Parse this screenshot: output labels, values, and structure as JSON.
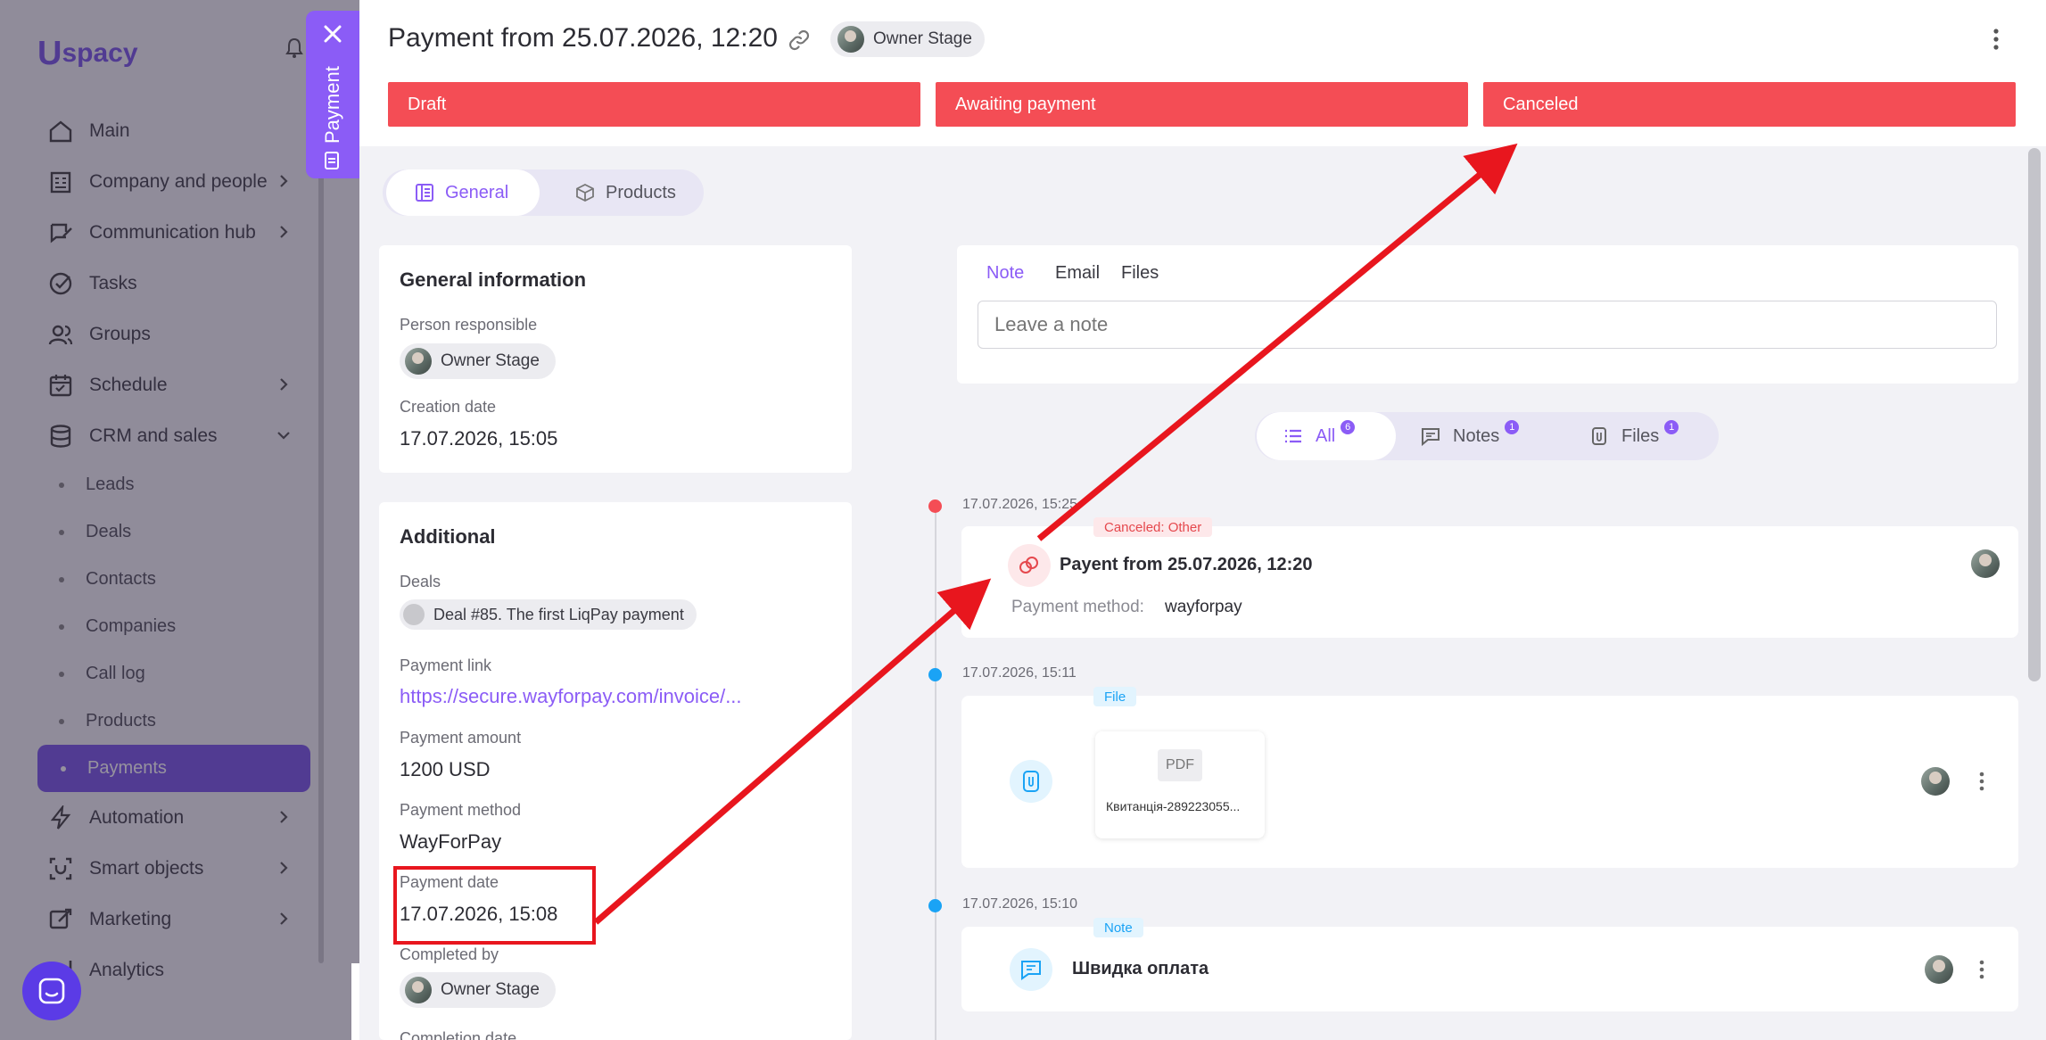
{
  "sidebar": {
    "logo_u": "U",
    "logo_text": "spacy",
    "items": [
      {
        "label": "Main",
        "icon": "home-icon",
        "has_chevron": false
      },
      {
        "label": "Company and people",
        "icon": "company-icon",
        "has_chevron": true
      },
      {
        "label": "Communication hub",
        "icon": "communication-icon",
        "has_chevron": true
      },
      {
        "label": "Tasks",
        "icon": "tasks-icon",
        "has_chevron": false
      },
      {
        "label": "Groups",
        "icon": "groups-icon",
        "has_chevron": false
      },
      {
        "label": "Schedule",
        "icon": "calendar-icon",
        "has_chevron": true
      },
      {
        "label": "CRM and sales",
        "icon": "database-icon",
        "has_chevron": true,
        "expanded": true
      }
    ],
    "crm_subitems": [
      "Leads",
      "Deals",
      "Contacts",
      "Companies",
      "Call log",
      "Products",
      "Payments"
    ],
    "active_subitem": "Payments",
    "items_bottom": [
      {
        "label": "Automation",
        "icon": "lightning-icon"
      },
      {
        "label": "Smart objects",
        "icon": "smart-objects-icon"
      },
      {
        "label": "Marketing",
        "icon": "marketing-icon"
      },
      {
        "label": "Analytics",
        "icon": "analytics-icon"
      }
    ]
  },
  "vertical_tab": {
    "label": "Payment"
  },
  "header": {
    "title": "Payment from 25.07.2026, 12:20",
    "owner": "Owner Stage",
    "stages": [
      "Draft",
      "Awaiting payment",
      "Canceled"
    ],
    "stage_color": "#f44d55"
  },
  "tabs": {
    "general": "General",
    "products": "Products"
  },
  "general_info": {
    "title": "General information",
    "person_responsible_label": "Person responsible",
    "person_responsible": "Owner Stage",
    "creation_date_label": "Creation date",
    "creation_date": "17.07.2026, 15:05"
  },
  "additional": {
    "title": "Additional",
    "deals_label": "Deals",
    "deal": "Deal #85. The first LiqPay payment",
    "payment_link_label": "Payment link",
    "payment_link": "https://secure.wayforpay.com/invoice/...",
    "payment_amount_label": "Payment amount",
    "payment_amount": "1200 USD",
    "payment_method_label": "Payment method",
    "payment_method": "WayForPay",
    "payment_date_label": "Payment date",
    "payment_date": "17.07.2026, 15:08",
    "completed_by_label": "Completed by",
    "completed_by": "Owner Stage",
    "completion_date_label": "Completion date"
  },
  "note_box": {
    "tabs": [
      "Note",
      "Email",
      "Files"
    ],
    "active_tab": "Note",
    "placeholder": "Leave a note"
  },
  "filters": [
    {
      "label": "All",
      "count": "6"
    },
    {
      "label": "Notes",
      "count": "1"
    },
    {
      "label": "Files",
      "count": "1"
    }
  ],
  "timeline": [
    {
      "time": "17.07.2026, 15:25",
      "tag": "Canceled: Other",
      "title": "Payent from 25.07.2026, 12:20",
      "method_label": "Payment method:",
      "method": "wayforpay",
      "dot_color": "#f44d55"
    },
    {
      "time": "17.07.2026, 15:11",
      "tag": "File",
      "file_type": "PDF",
      "file_name": "Квитанція-289223055...",
      "dot_color": "#1aa3f5"
    },
    {
      "time": "17.07.2026, 15:10",
      "tag": "Note",
      "title": "Швидка оплата",
      "dot_color": "#1aa3f5"
    }
  ],
  "colors": {
    "accent": "#8b5cf6",
    "stage_red": "#f44d55",
    "annotation_red": "#e8161e",
    "timeline_blue": "#1aa3f5"
  }
}
